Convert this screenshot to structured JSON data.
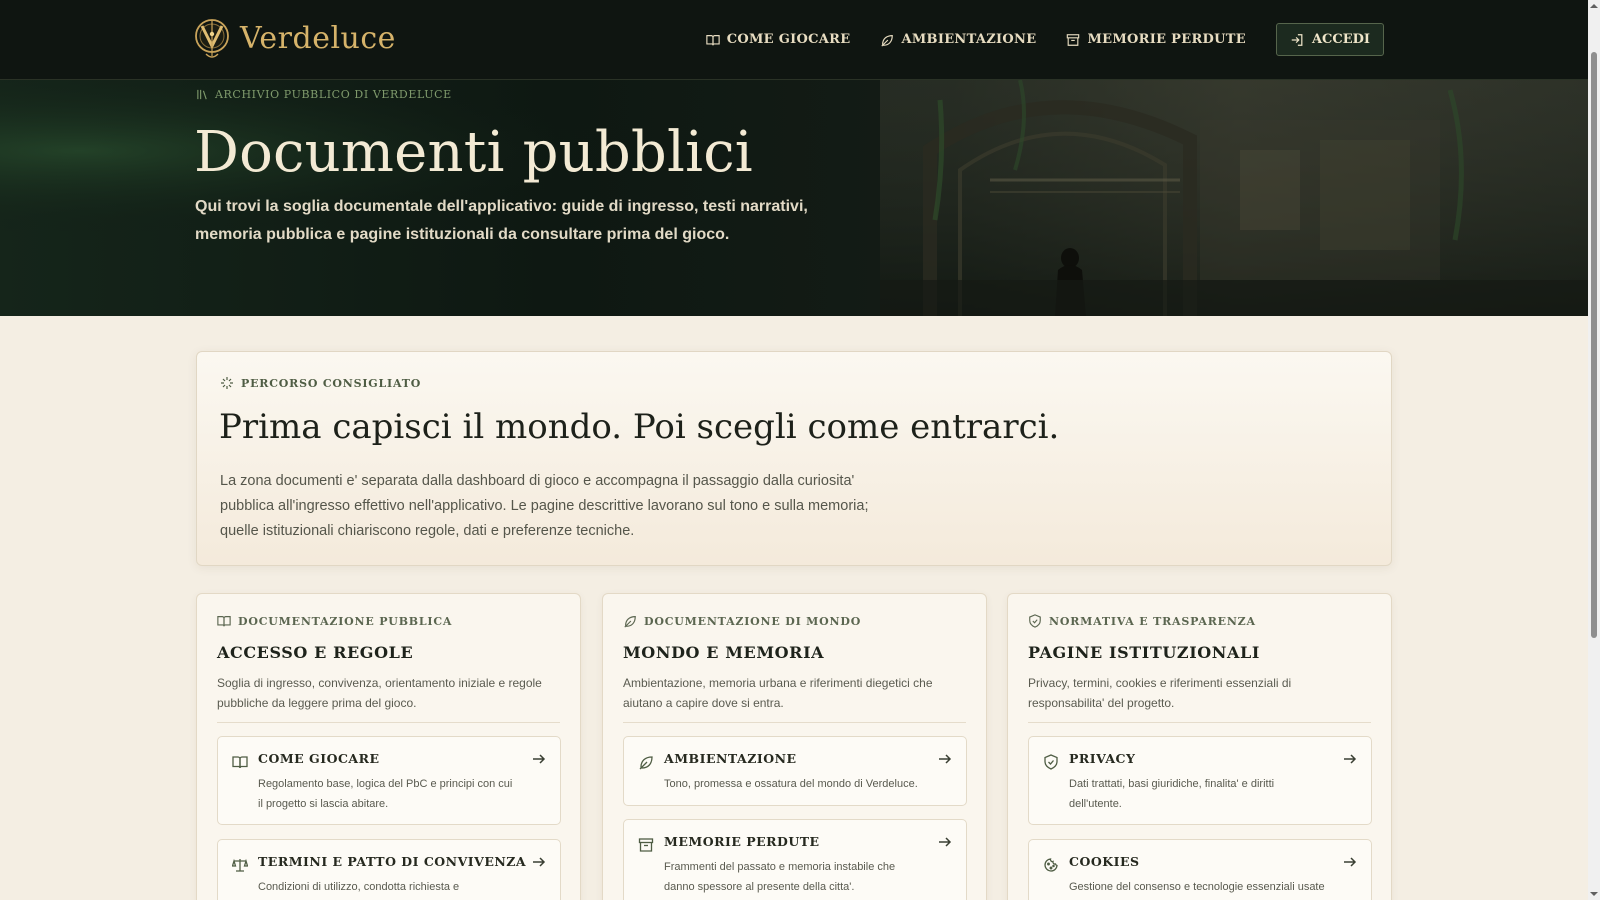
{
  "brand": {
    "name": "Verdeluce",
    "colors": {
      "gold": "#d6b36a",
      "dark": "#0f1511",
      "accent_green": "#4f5d44",
      "paper": "#f4eee3"
    }
  },
  "nav": {
    "items": [
      {
        "label": "COME GIOCARE",
        "icon": "book-open-icon"
      },
      {
        "label": "AMBIENTAZIONE",
        "icon": "leaf-icon"
      },
      {
        "label": "MEMORIE PERDUTE",
        "icon": "archive-box-icon"
      }
    ],
    "login_label": "ACCEDI",
    "login_icon": "login-icon"
  },
  "hero": {
    "kicker": "ARCHIVIO PUBBLICO DI VERDELUCE",
    "title": "Documenti pubblici",
    "description": "Qui trovi la soglia documentale dell'applicativo: guide di ingresso, testi narrativi, memoria pubblica e pagine istituzionali da consultare prima del gioco."
  },
  "featured": {
    "kicker": "PERCORSO CONSIGLIATO",
    "title": "Prima capisci il mondo. Poi scegli come entrarci.",
    "description": "La zona documenti e' separata dalla dashboard di gioco e accompagna il passaggio dalla curiosita' pubblica all'ingresso effettivo nell'applicativo. Le pagine descrittive lavorano sul tono e sulla memoria; quelle istituzionali chiariscono regole, dati e preferenze tecniche."
  },
  "columns": [
    {
      "kicker": "DOCUMENTAZIONE PUBBLICA",
      "icon": "book-open-icon",
      "title": "ACCESSO E REGOLE",
      "description": "Soglia di ingresso, convivenza, orientamento iniziale e regole pubbliche da leggere prima del gioco.",
      "items": [
        {
          "title": "COME GIOCARE",
          "icon": "book-open-icon",
          "description": "Regolamento base, logica del PbC e principi con cui il progetto si lascia abitare."
        },
        {
          "title": "TERMINI E PATTO DI CONVIVENZA",
          "icon": "scales-icon",
          "description": "Condizioni di utilizzo, condotta richiesta e"
        }
      ]
    },
    {
      "kicker": "DOCUMENTAZIONE DI MONDO",
      "icon": "leaf-icon",
      "title": "MONDO E MEMORIA",
      "description": "Ambientazione, memoria urbana e riferimenti diegetici che aiutano a capire dove si entra.",
      "items": [
        {
          "title": "AMBIENTAZIONE",
          "icon": "leaf-icon",
          "description": "Tono, promessa e ossatura del mondo di Verdeluce."
        },
        {
          "title": "MEMORIE PERDUTE",
          "icon": "archive-box-icon",
          "description": "Frammenti del passato e memoria instabile che danno spessore al presente della citta'."
        }
      ]
    },
    {
      "kicker": "NORMATIVA E TRASPARENZA",
      "icon": "shield-check-icon",
      "title": "PAGINE ISTITUZIONALI",
      "description": "Privacy, termini, cookies e riferimenti essenziali di responsabilita' del progetto.",
      "items": [
        {
          "title": "PRIVACY",
          "icon": "shield-check-icon",
          "description": "Dati trattati, basi giuridiche, finalita' e diritti dell'utente."
        },
        {
          "title": "COOKIES",
          "icon": "cookie-icon",
          "description": "Gestione del consenso e tecnologie essenziali usate"
        }
      ]
    }
  ]
}
